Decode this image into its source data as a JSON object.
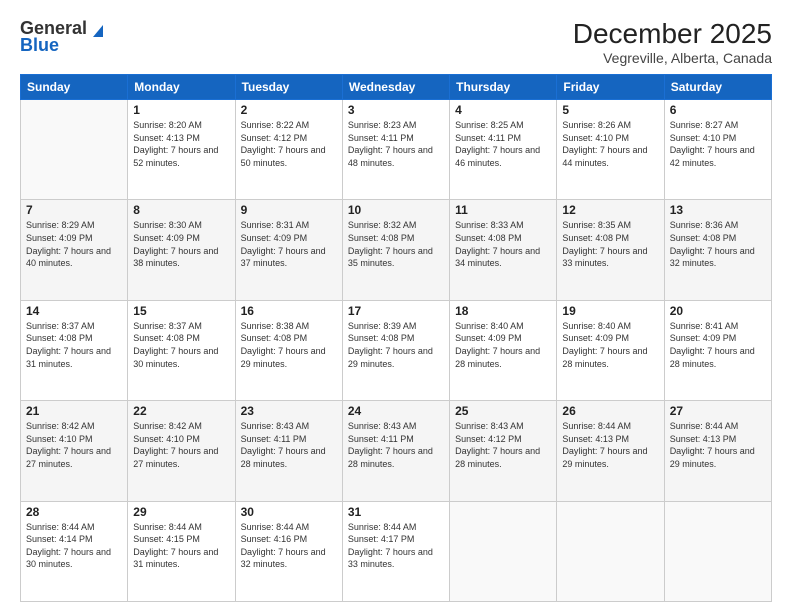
{
  "header": {
    "logo_general": "General",
    "logo_blue": "Blue",
    "title": "December 2025",
    "subtitle": "Vegreville, Alberta, Canada"
  },
  "weekdays": [
    "Sunday",
    "Monday",
    "Tuesday",
    "Wednesday",
    "Thursday",
    "Friday",
    "Saturday"
  ],
  "weeks": [
    [
      {
        "day": "",
        "sunrise": "",
        "sunset": "",
        "daylight": ""
      },
      {
        "day": "1",
        "sunrise": "Sunrise: 8:20 AM",
        "sunset": "Sunset: 4:13 PM",
        "daylight": "Daylight: 7 hours and 52 minutes."
      },
      {
        "day": "2",
        "sunrise": "Sunrise: 8:22 AM",
        "sunset": "Sunset: 4:12 PM",
        "daylight": "Daylight: 7 hours and 50 minutes."
      },
      {
        "day": "3",
        "sunrise": "Sunrise: 8:23 AM",
        "sunset": "Sunset: 4:11 PM",
        "daylight": "Daylight: 7 hours and 48 minutes."
      },
      {
        "day": "4",
        "sunrise": "Sunrise: 8:25 AM",
        "sunset": "Sunset: 4:11 PM",
        "daylight": "Daylight: 7 hours and 46 minutes."
      },
      {
        "day": "5",
        "sunrise": "Sunrise: 8:26 AM",
        "sunset": "Sunset: 4:10 PM",
        "daylight": "Daylight: 7 hours and 44 minutes."
      },
      {
        "day": "6",
        "sunrise": "Sunrise: 8:27 AM",
        "sunset": "Sunset: 4:10 PM",
        "daylight": "Daylight: 7 hours and 42 minutes."
      }
    ],
    [
      {
        "day": "7",
        "sunrise": "Sunrise: 8:29 AM",
        "sunset": "Sunset: 4:09 PM",
        "daylight": "Daylight: 7 hours and 40 minutes."
      },
      {
        "day": "8",
        "sunrise": "Sunrise: 8:30 AM",
        "sunset": "Sunset: 4:09 PM",
        "daylight": "Daylight: 7 hours and 38 minutes."
      },
      {
        "day": "9",
        "sunrise": "Sunrise: 8:31 AM",
        "sunset": "Sunset: 4:09 PM",
        "daylight": "Daylight: 7 hours and 37 minutes."
      },
      {
        "day": "10",
        "sunrise": "Sunrise: 8:32 AM",
        "sunset": "Sunset: 4:08 PM",
        "daylight": "Daylight: 7 hours and 35 minutes."
      },
      {
        "day": "11",
        "sunrise": "Sunrise: 8:33 AM",
        "sunset": "Sunset: 4:08 PM",
        "daylight": "Daylight: 7 hours and 34 minutes."
      },
      {
        "day": "12",
        "sunrise": "Sunrise: 8:35 AM",
        "sunset": "Sunset: 4:08 PM",
        "daylight": "Daylight: 7 hours and 33 minutes."
      },
      {
        "day": "13",
        "sunrise": "Sunrise: 8:36 AM",
        "sunset": "Sunset: 4:08 PM",
        "daylight": "Daylight: 7 hours and 32 minutes."
      }
    ],
    [
      {
        "day": "14",
        "sunrise": "Sunrise: 8:37 AM",
        "sunset": "Sunset: 4:08 PM",
        "daylight": "Daylight: 7 hours and 31 minutes."
      },
      {
        "day": "15",
        "sunrise": "Sunrise: 8:37 AM",
        "sunset": "Sunset: 4:08 PM",
        "daylight": "Daylight: 7 hours and 30 minutes."
      },
      {
        "day": "16",
        "sunrise": "Sunrise: 8:38 AM",
        "sunset": "Sunset: 4:08 PM",
        "daylight": "Daylight: 7 hours and 29 minutes."
      },
      {
        "day": "17",
        "sunrise": "Sunrise: 8:39 AM",
        "sunset": "Sunset: 4:08 PM",
        "daylight": "Daylight: 7 hours and 29 minutes."
      },
      {
        "day": "18",
        "sunrise": "Sunrise: 8:40 AM",
        "sunset": "Sunset: 4:09 PM",
        "daylight": "Daylight: 7 hours and 28 minutes."
      },
      {
        "day": "19",
        "sunrise": "Sunrise: 8:40 AM",
        "sunset": "Sunset: 4:09 PM",
        "daylight": "Daylight: 7 hours and 28 minutes."
      },
      {
        "day": "20",
        "sunrise": "Sunrise: 8:41 AM",
        "sunset": "Sunset: 4:09 PM",
        "daylight": "Daylight: 7 hours and 28 minutes."
      }
    ],
    [
      {
        "day": "21",
        "sunrise": "Sunrise: 8:42 AM",
        "sunset": "Sunset: 4:10 PM",
        "daylight": "Daylight: 7 hours and 27 minutes."
      },
      {
        "day": "22",
        "sunrise": "Sunrise: 8:42 AM",
        "sunset": "Sunset: 4:10 PM",
        "daylight": "Daylight: 7 hours and 27 minutes."
      },
      {
        "day": "23",
        "sunrise": "Sunrise: 8:43 AM",
        "sunset": "Sunset: 4:11 PM",
        "daylight": "Daylight: 7 hours and 28 minutes."
      },
      {
        "day": "24",
        "sunrise": "Sunrise: 8:43 AM",
        "sunset": "Sunset: 4:11 PM",
        "daylight": "Daylight: 7 hours and 28 minutes."
      },
      {
        "day": "25",
        "sunrise": "Sunrise: 8:43 AM",
        "sunset": "Sunset: 4:12 PM",
        "daylight": "Daylight: 7 hours and 28 minutes."
      },
      {
        "day": "26",
        "sunrise": "Sunrise: 8:44 AM",
        "sunset": "Sunset: 4:13 PM",
        "daylight": "Daylight: 7 hours and 29 minutes."
      },
      {
        "day": "27",
        "sunrise": "Sunrise: 8:44 AM",
        "sunset": "Sunset: 4:13 PM",
        "daylight": "Daylight: 7 hours and 29 minutes."
      }
    ],
    [
      {
        "day": "28",
        "sunrise": "Sunrise: 8:44 AM",
        "sunset": "Sunset: 4:14 PM",
        "daylight": "Daylight: 7 hours and 30 minutes."
      },
      {
        "day": "29",
        "sunrise": "Sunrise: 8:44 AM",
        "sunset": "Sunset: 4:15 PM",
        "daylight": "Daylight: 7 hours and 31 minutes."
      },
      {
        "day": "30",
        "sunrise": "Sunrise: 8:44 AM",
        "sunset": "Sunset: 4:16 PM",
        "daylight": "Daylight: 7 hours and 32 minutes."
      },
      {
        "day": "31",
        "sunrise": "Sunrise: 8:44 AM",
        "sunset": "Sunset: 4:17 PM",
        "daylight": "Daylight: 7 hours and 33 minutes."
      },
      {
        "day": "",
        "sunrise": "",
        "sunset": "",
        "daylight": ""
      },
      {
        "day": "",
        "sunrise": "",
        "sunset": "",
        "daylight": ""
      },
      {
        "day": "",
        "sunrise": "",
        "sunset": "",
        "daylight": ""
      }
    ]
  ]
}
